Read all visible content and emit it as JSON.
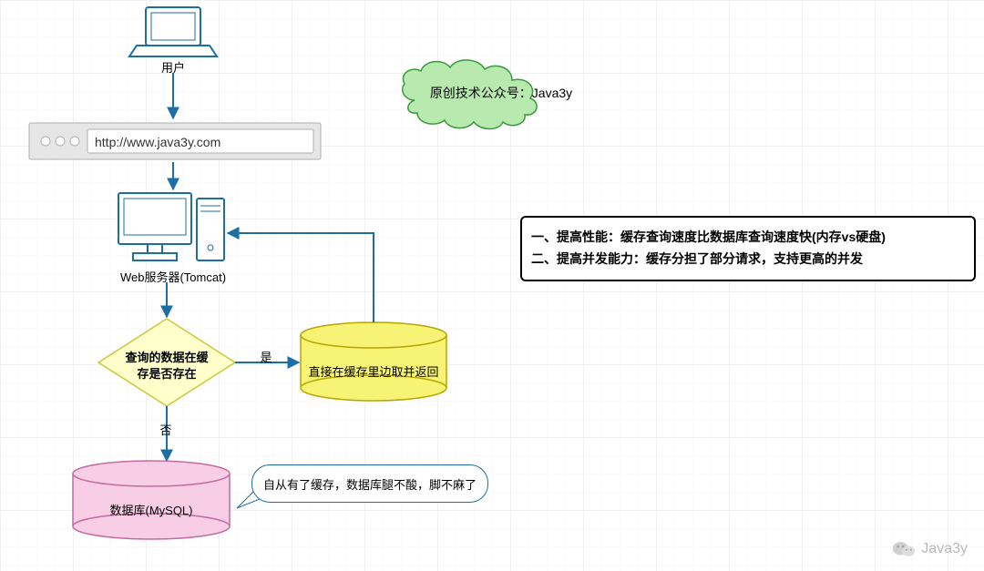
{
  "nodes": {
    "user_label": "用户",
    "url": "http://www.java3y.com",
    "web_server_label": "Web服务器(Tomcat)",
    "decision_text1": "查询的数据在缓",
    "decision_text2": "存是否存在",
    "edge_yes": "是",
    "edge_no": "否",
    "cache_cylinder_label": "直接在缓存里边取并返回",
    "db_label": "数据库(MySQL)",
    "speech_bubble": "自从有了缓存，数据库腿不酸，脚不麻了"
  },
  "cloud": {
    "text": "原创技术公众号：Java3y"
  },
  "info_box": {
    "line1": "一、提高性能：缓存查询速度比数据库查询速度快(内存vs硬盘)",
    "line2": "二、提高并发能力：缓存分担了部分请求，支持更高的并发"
  },
  "watermark": {
    "text": "Java3y"
  }
}
